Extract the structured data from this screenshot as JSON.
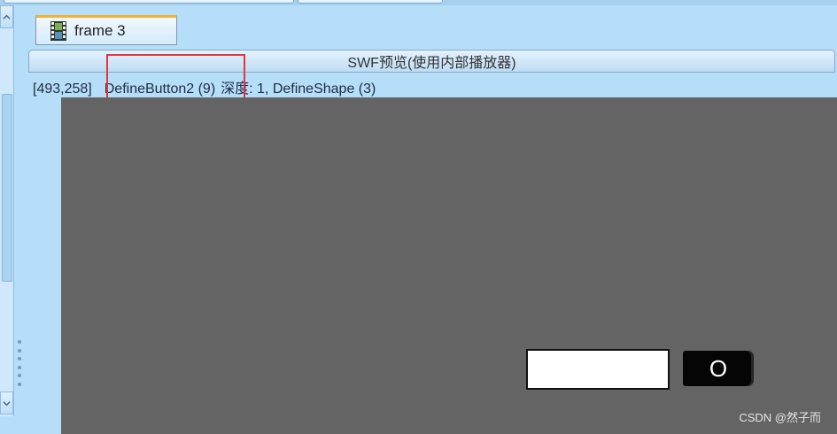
{
  "frame_tab": {
    "label": "frame 3",
    "icon": "film-icon"
  },
  "preview_bar": {
    "title": "SWF预览(使用内部播放器)"
  },
  "status": {
    "coordinates": "[493,258]",
    "button_name": "DefineButton2 (9)",
    "depth_info": "深度: 1, DefineShape (3)"
  },
  "canvas": {
    "background": "#646464",
    "button_label": "O"
  },
  "watermark": {
    "text": "CSDN @然子而"
  },
  "colors": {
    "app_background": "#b7def9",
    "highlight": "#e8333b",
    "tab_accent": "#f2b233"
  }
}
